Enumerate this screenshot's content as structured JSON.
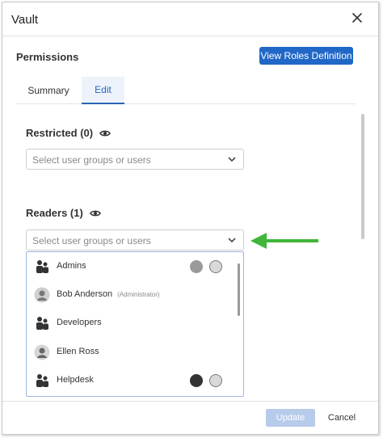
{
  "window": {
    "title": "Vault"
  },
  "permissions": {
    "title": "Permissions",
    "roles_button": "View Roles Definition"
  },
  "tabs": [
    {
      "label": "Summary",
      "active": false
    },
    {
      "label": "Edit",
      "active": true
    }
  ],
  "restricted": {
    "label": "Restricted (0)",
    "placeholder": "Select user groups or users"
  },
  "readers": {
    "label": "Readers (1)",
    "placeholder": "Select user groups or users"
  },
  "dropdown": {
    "items": [
      {
        "name": "Admins",
        "note": "",
        "kind": "group-icon",
        "badges": 2
      },
      {
        "name": "Bob Anderson",
        "note": "(Administrator)",
        "kind": "user-avatar-icon",
        "badges": 0
      },
      {
        "name": "Developers",
        "note": "",
        "kind": "group-icon",
        "badges": 0
      },
      {
        "name": "Ellen Ross",
        "note": "",
        "kind": "user-avatar-icon",
        "badges": 0
      },
      {
        "name": "Helpdesk",
        "note": "",
        "kind": "group-icon",
        "badges": 2
      }
    ]
  },
  "footer": {
    "update_label": "Update",
    "cancel_label": "Cancel"
  },
  "colors": {
    "accent": "#2167c7",
    "arrow": "#3fb639",
    "disabled": "#b7cbea"
  }
}
